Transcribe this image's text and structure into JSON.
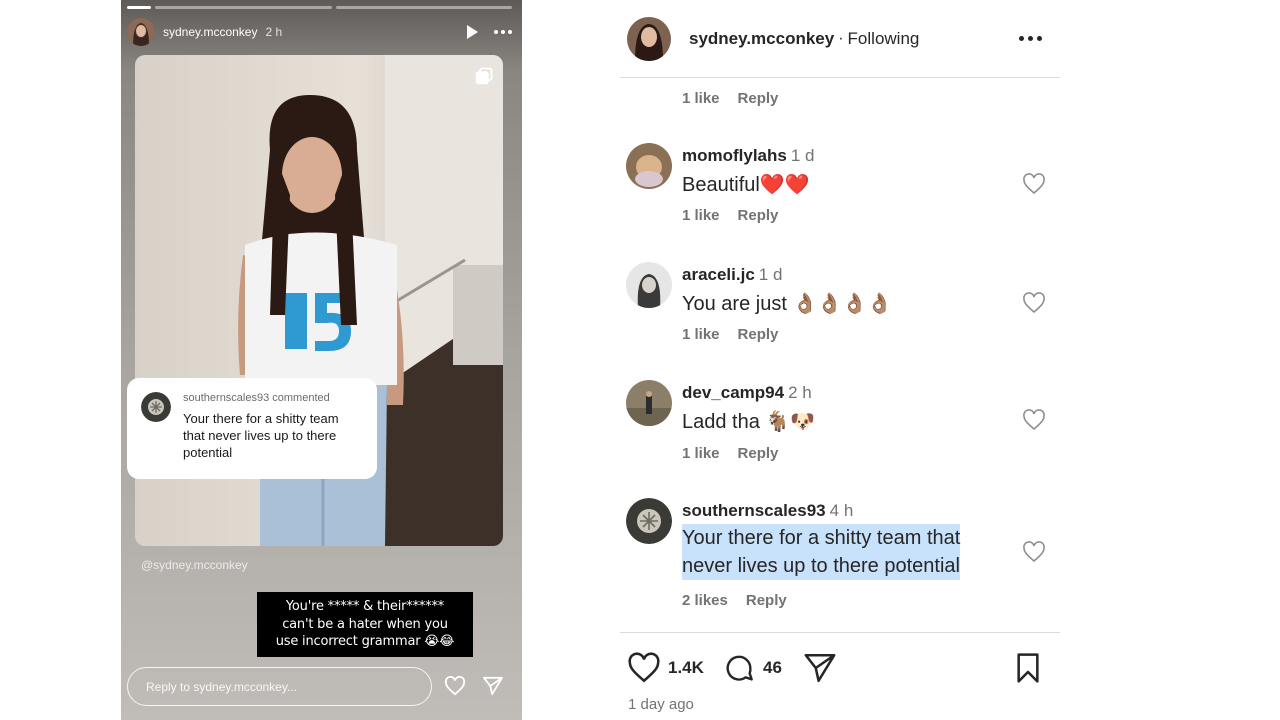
{
  "story": {
    "username": "sydney.mcconkey",
    "time": "2 h",
    "mention": "@sydney.mcconkey",
    "comment_sticker": {
      "meta": "southernscales93 commented",
      "text": "Your there for a shitty team that never lives up to there potential"
    },
    "caption_lines": [
      "You're ***** & their******",
      "can't be a hater when you",
      "use incorrect grammar 😭😂"
    ],
    "reply_placeholder": "Reply to sydney.mcconkey..."
  },
  "post": {
    "username": "sydney.mcconkey",
    "separator": "·",
    "follow_status": "Following",
    "top_meta": {
      "likes": "1 like",
      "reply": "Reply"
    },
    "comments": [
      {
        "user": "momoflylahs",
        "time": "1 d",
        "text": "Beautiful❤️❤️",
        "likes": "1 like",
        "reply": "Reply"
      },
      {
        "user": "araceli.jc",
        "time": "1 d",
        "text": "You are just 👌🏽👌🏽👌🏽👌🏽",
        "likes": "1 like",
        "reply": "Reply"
      },
      {
        "user": "dev_camp94",
        "time": "2 h",
        "text": "Ladd tha 🐐🐶",
        "likes": "1 like",
        "reply": "Reply"
      },
      {
        "user": "southernscales93",
        "time": "4 h",
        "text_lines": [
          "Your there for a shitty team that",
          "never lives up to there potential"
        ],
        "likes": "2 likes",
        "reply": "Reply"
      }
    ],
    "actions": {
      "likes": "1.4K",
      "comments": "46"
    },
    "date": "1 day ago"
  }
}
